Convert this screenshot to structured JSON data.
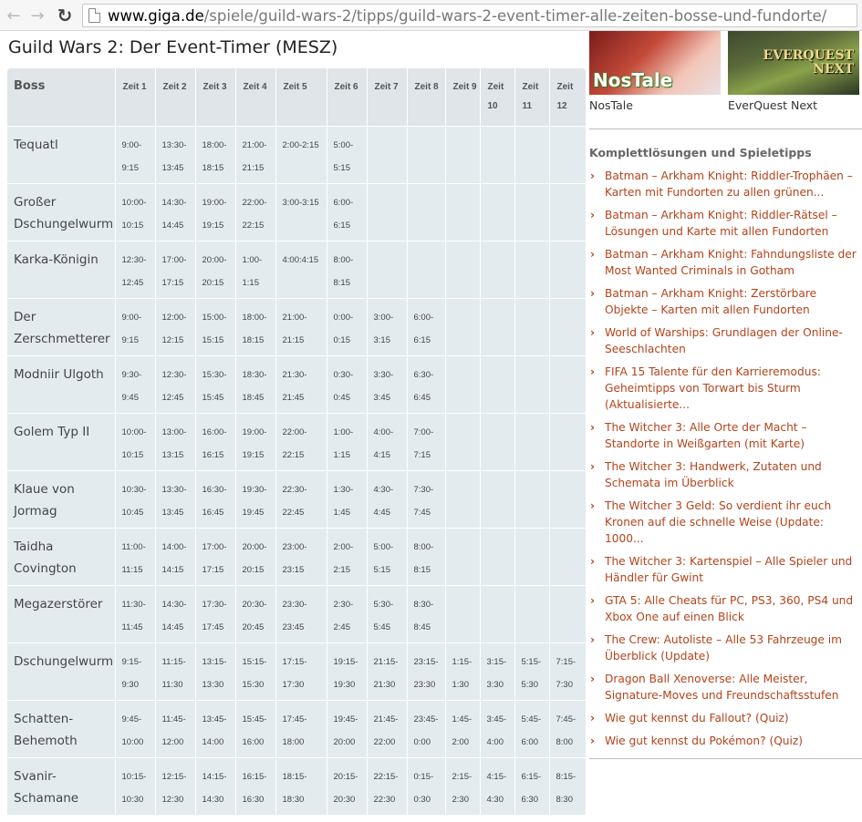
{
  "browser": {
    "url_host": "www.giga.de",
    "url_path": "/spiele/guild-wars-2/tipps/guild-wars-2-event-timer-alle-zeiten-bosse-und-fundorte/"
  },
  "page": {
    "title": "Guild Wars 2: Der Event-Timer (MESZ)"
  },
  "table": {
    "headers": [
      "Boss",
      "Zeit 1",
      "Zeit 2",
      "Zeit 3",
      "Zeit 4",
      "Zeit 5",
      "Zeit 6",
      "Zeit 7",
      "Zeit 8",
      "Zeit 9",
      "Zeit 10",
      "Zeit 11",
      "Zeit 12"
    ],
    "rows": [
      {
        "boss": "Tequatl",
        "color": "red",
        "times": [
          "9:00-9:15",
          "13:30-13:45",
          "18:00-18:15",
          "21:00-21:15",
          "2:00-2:15",
          "5:00-5:15",
          "",
          "",
          "",
          "",
          "",
          ""
        ]
      },
      {
        "boss": "Großer Dschungelwurm",
        "color": "red",
        "times": [
          "10:00-10:15",
          "14:30-14:45",
          "19:00-19:15",
          "22:00-22:15",
          "3:00-3:15",
          "6:00-6:15",
          "",
          "",
          "",
          "",
          "",
          ""
        ]
      },
      {
        "boss": "Karka-Königin",
        "color": "red",
        "times": [
          "12:30-12:45",
          "17:00-17:15",
          "20:00-20:15",
          "1:00-1:15",
          "4:00:4:15",
          "8:00-8:15",
          "",
          "",
          "",
          "",
          "",
          ""
        ]
      },
      {
        "boss": "Der Zerschmetterer",
        "color": "blue",
        "times": [
          "9:00-9:15",
          "12:00-12:15",
          "15:00-15:15",
          "18:00-18:15",
          "21:00-21:15",
          "0:00-0:15",
          "3:00-3:15",
          "6:00-6:15",
          "",
          "",
          "",
          ""
        ]
      },
      {
        "boss": "Modniir Ulgoth",
        "color": "blue",
        "times": [
          "9:30-9:45",
          "12:30-12:45",
          "15:30-15:45",
          "18:30-18:45",
          "21:30-21:45",
          "0:30-0:45",
          "3:30-3:45",
          "6:30-6:45",
          "",
          "",
          "",
          ""
        ]
      },
      {
        "boss": "Golem Typ II",
        "color": "blue",
        "times": [
          "10:00-10:15",
          "13:00-13:15",
          "16:00-16:15",
          "19:00-19:15",
          "22:00-22:15",
          "1:00-1:15",
          "4:00-4:15",
          "7:00-7:15",
          "",
          "",
          "",
          ""
        ]
      },
      {
        "boss": "Klaue von Jormag",
        "color": "blue",
        "times": [
          "10:30-10:45",
          "13:30-13:45",
          "16:30-16:45",
          "19:30-19:45",
          "22:30-22:45",
          "1:30-1:45",
          "4:30-4:45",
          "7:30-7:45",
          "",
          "",
          "",
          ""
        ]
      },
      {
        "boss": "Taidha Covington",
        "color": "blue",
        "times": [
          "11:00-11:15",
          "14:00-14:15",
          "17:00-17:15",
          "20:00-20:15",
          "23:00-23:15",
          "2:00-2:15",
          "5:00-5:15",
          "8:00-8:15",
          "",
          "",
          "",
          ""
        ]
      },
      {
        "boss": "Megazerstörer",
        "color": "blue",
        "times": [
          "11:30-11:45",
          "14:30-14:45",
          "17:30-17:45",
          "20:30-20:45",
          "23:30-23:45",
          "2:30-2:45",
          "5:30-5:45",
          "8:30-8:45",
          "",
          "",
          "",
          ""
        ]
      },
      {
        "boss": "Dschungelwurm",
        "color": "green",
        "times": [
          "9:15-9:30",
          "11:15-11:30",
          "13:15-13:30",
          "15:15-15:30",
          "17:15-17:30",
          "19:15-19:30",
          "21:15-21:30",
          "23:15-23:30",
          "1:15-1:30",
          "3:15-3:30",
          "5:15-5:30",
          "7:15-7:30"
        ]
      },
      {
        "boss": "Schatten-Behemoth",
        "color": "green",
        "times": [
          "9:45-10:00",
          "11:45-12:00",
          "13:45-14:00",
          "15:45-16:00",
          "17:45-18:00",
          "19:45-20:00",
          "21:45-22:00",
          "23:45-0:00",
          "1:45-2:00",
          "3:45-4:00",
          "5:45-6:00",
          "7:45-8:00"
        ]
      },
      {
        "boss": "Svanir-Schamane",
        "color": "green",
        "times": [
          "10:15-10:30",
          "12:15-12:30",
          "14:15-14:30",
          "16:15-16:30",
          "18:15-18:30",
          "20:15-20:30",
          "22:15-22:30",
          "0:15-0:30",
          "2:15-2:30",
          "4:15-4:30",
          "6:15-6:30",
          "8:15-8:30"
        ]
      }
    ]
  },
  "sidebar": {
    "thumbs": [
      {
        "caption": "NosTale",
        "logo": "NosTale"
      },
      {
        "caption": "EverQuest Next",
        "logo": "EVERQUEST NEXT"
      }
    ],
    "heading": "Komplettlösungen und Spieletipps",
    "links": [
      "Batman – Arkham Knight: Riddler-Trophäen – Karten mit Fundorten zu allen grünen...",
      "Batman – Arkham Knight: Riddler-Rätsel – Lösungen und Karte mit allen Fundorten",
      "Batman – Arkham Knight: Fahndungsliste der Most Wanted Criminals in Gotham",
      "Batman – Arkham Knight: Zerstörbare Objekte – Karten mit allen Fundorten",
      "World of Warships: Grundlagen der Online-Seeschlachten",
      "FIFA 15 Talente für den Karrieremodus: Geheimtipps von Torwart bis Sturm (Aktualisierte...",
      "The Witcher 3: Alle Orte der Macht – Standorte in Weißgarten (mit Karte)",
      "The Witcher 3: Handwerk, Zutaten und Schemata im Überblick",
      "The Witcher 3 Geld: So verdient ihr euch Kronen auf die schnelle Weise (Update: 1000...",
      "The Witcher 3: Kartenspiel – Alle Spieler und Händler für Gwint",
      "GTA 5: Alle Cheats für PC, PS3, 360, PS4 und Xbox One auf einen Blick",
      "The Crew: Autoliste – Alle 53 Fahrzeuge im Überblick (Update)",
      "Dragon Ball Xenoverse: Alle Meister, Signature-Moves und Freundschaftsstufen",
      "Wie gut kennst du Fallout? (Quiz)",
      "Wie gut kennst du Pokémon? (Quiz)"
    ]
  }
}
